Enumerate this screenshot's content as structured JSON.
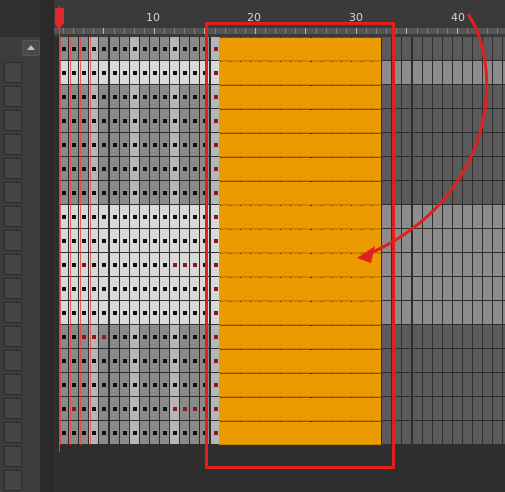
{
  "timeline": {
    "ruler": {
      "labels": [
        "10",
        "20",
        "30",
        "40"
      ]
    },
    "current_frame": 1,
    "track_count": 17,
    "selected_frames": [
      17,
      32
    ],
    "colors": {
      "selection": "#eb9a00",
      "annotation": "#e01f1f",
      "playhead": "#e22828"
    }
  },
  "annotation": {
    "box_icon": "highlight-rectangle",
    "arrow_icon": "curved-arrow"
  }
}
